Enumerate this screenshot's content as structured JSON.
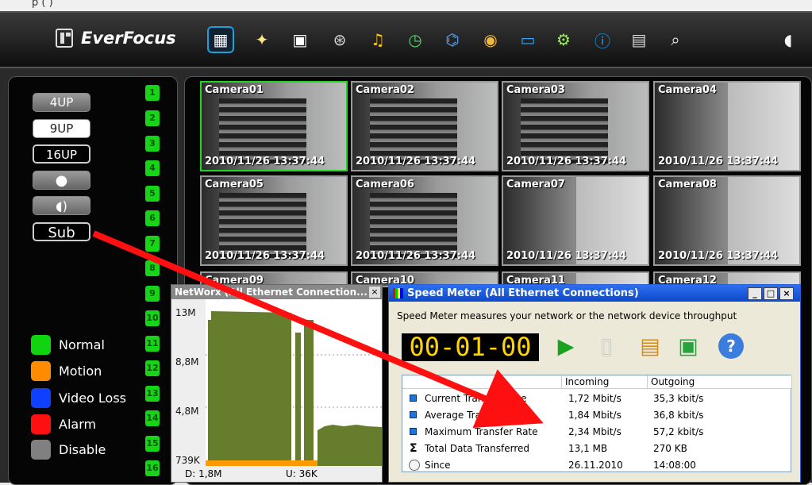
{
  "top_fragment": "p (                )",
  "app": {
    "brand": "EverFocus"
  },
  "toolbar": {
    "icons": [
      "live-view-icon",
      "wand-icon",
      "camera-icon",
      "film-reel-icon",
      "bell-icon",
      "schedule-clock-icon",
      "network-icon",
      "disk-icon",
      "monitor-icon",
      "gears-icon",
      "info-icon",
      "filmstrip-icon",
      "search-document-icon",
      "dome-camera-icon"
    ]
  },
  "left_panel": {
    "layout_buttons": [
      "4UP",
      "9UP",
      "16UP"
    ],
    "other_buttons": {
      "sub": "Sub"
    },
    "channels": [
      "1",
      "2",
      "3",
      "4",
      "5",
      "6",
      "7",
      "8",
      "9",
      "10",
      "11",
      "12",
      "13",
      "14",
      "15",
      "16"
    ],
    "legend": [
      {
        "label": "Normal",
        "color": "#10d410"
      },
      {
        "label": "Motion",
        "color": "#ff8c00"
      },
      {
        "label": "Video Loss",
        "color": "#1040ff"
      },
      {
        "label": "Alarm",
        "color": "#ff1010"
      },
      {
        "label": "Disable",
        "color": "#808080"
      }
    ]
  },
  "cameras": [
    {
      "name": "Camera01",
      "time": "2010/11/26  13:37:44",
      "selected": true,
      "scene": "rack"
    },
    {
      "name": "Camera02",
      "time": "2010/11/26  13:37:44",
      "scene": "outdoor"
    },
    {
      "name": "Camera03",
      "time": "2010/11/26  13:37:44",
      "scene": "outdoor"
    },
    {
      "name": "Camera04",
      "time": "2010/11/26  13:37:44",
      "scene": "wall"
    },
    {
      "name": "Camera05",
      "time": "2010/11/26  13:37:44",
      "scene": "outdoor"
    },
    {
      "name": "Camera06",
      "time": "2010/11/26  13:37:44",
      "scene": "rack"
    },
    {
      "name": "Camera07",
      "time": "2010/11/26  13:37:44",
      "scene": "wall"
    },
    {
      "name": "Camera08",
      "time": "2010/11/26  13:37:44",
      "scene": "wall"
    },
    {
      "name": "Camera09",
      "time": "",
      "scene": "outdoor"
    },
    {
      "name": "Camera10",
      "time": "",
      "scene": "rack"
    },
    {
      "name": "Camera11",
      "time": "",
      "scene": "wall"
    },
    {
      "name": "Camera12",
      "time": "",
      "scene": "wall"
    }
  ],
  "networx": {
    "title": "NetWorx (All Ethernet Connection...",
    "close": "×",
    "axis": [
      "13M",
      "8,8M",
      "4,8M",
      "739K"
    ],
    "download": "D: 1,8M",
    "upload": "U: 36K"
  },
  "speed_meter": {
    "title": "Speed Meter (All Ethernet Connections)",
    "controls": {
      "minimize": "_",
      "maximize": "□",
      "close": "×"
    },
    "description": "Speed Meter measures your network or the network device throughput",
    "timer": "00-01-00",
    "columns": [
      "",
      "Incoming",
      "Outgoing"
    ],
    "rows": [
      {
        "label": "Current Transfer Rate",
        "incoming": "1,72 Mbit/s",
        "outgoing": "35,3 kbit/s",
        "icon": "bar"
      },
      {
        "label": "Average Transfer Rate",
        "incoming": "1,84 Mbit/s",
        "outgoing": "36,8 kbit/s",
        "icon": "bar"
      },
      {
        "label": "Maximum Transfer Rate",
        "incoming": "2,34 Mbit/s",
        "outgoing": "57,2 kbit/s",
        "icon": "bar"
      },
      {
        "label": "Total Data Transferred",
        "incoming": "13,1 MB",
        "outgoing": "270 KB",
        "icon": "sigma"
      },
      {
        "label": "Since",
        "incoming": "26.11.2010",
        "outgoing": "14:08:00",
        "icon": "clock"
      }
    ],
    "sigma": "Σ",
    "help": "?"
  }
}
